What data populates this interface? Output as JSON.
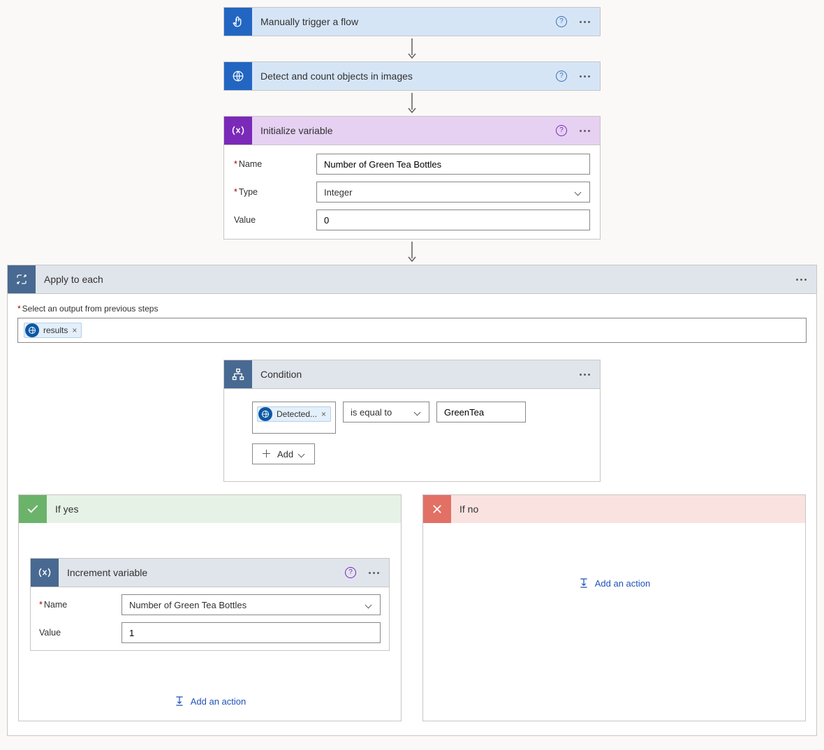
{
  "steps": {
    "trigger": {
      "title": "Manually trigger a flow"
    },
    "detect": {
      "title": "Detect and count objects in images"
    },
    "initVar": {
      "title": "Initialize variable",
      "nameLabel": "Name",
      "typeLabel": "Type",
      "valueLabel": "Value",
      "nameValue": "Number of Green Tea Bottles",
      "typeValue": "Integer",
      "valueValue": "0"
    }
  },
  "applyEach": {
    "title": "Apply to each",
    "selectLabel": "Select an output from previous steps",
    "token": "results"
  },
  "condition": {
    "title": "Condition",
    "lhsToken": "Detected...",
    "operator": "is equal to",
    "rhsValue": "GreenTea",
    "addLabel": "Add"
  },
  "branchYes": {
    "title": "If yes",
    "increment": {
      "title": "Increment variable",
      "nameLabel": "Name",
      "valueLabel": "Value",
      "nameValue": "Number of Green Tea Bottles",
      "valueValue": "1"
    },
    "addAction": "Add an action"
  },
  "branchNo": {
    "title": "If no",
    "addAction": "Add an action"
  }
}
